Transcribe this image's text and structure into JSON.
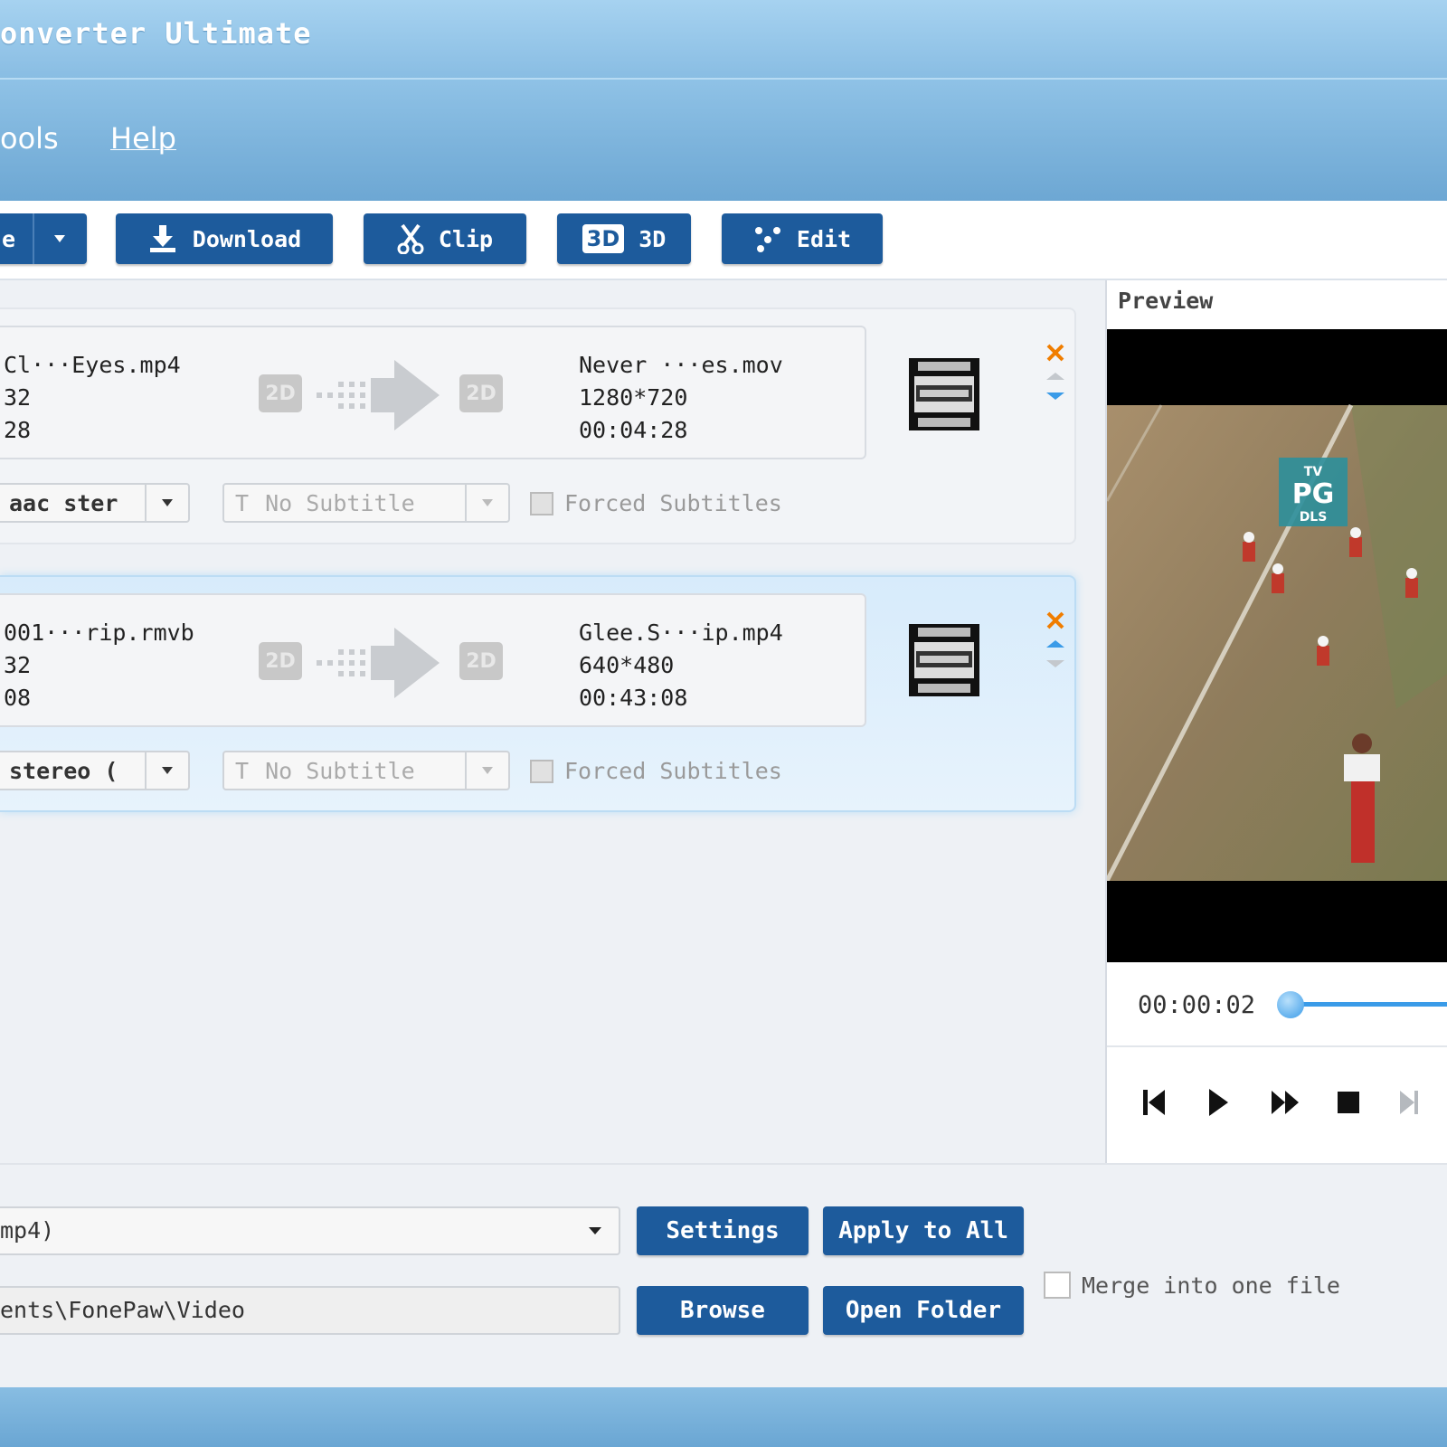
{
  "window": {
    "title": "onverter Ultimate"
  },
  "menu": {
    "items": [
      "ools",
      "Help"
    ]
  },
  "toolbar": {
    "buttons": [
      {
        "label": "e",
        "icon": "add-file-icon"
      },
      {
        "label": "Download",
        "icon": "download-icon"
      },
      {
        "label": "Clip",
        "icon": "scissors-icon"
      },
      {
        "label": "3D",
        "icon": "3d-icon",
        "badge": "3D"
      },
      {
        "label": "Edit",
        "icon": "edit-icon"
      }
    ]
  },
  "files": [
    {
      "source": {
        "name": "Cl···Eyes.mp4",
        "resolution": "32",
        "duration": "28"
      },
      "source_badge": "2D",
      "target_badge": "2D",
      "target": {
        "name": "Never ···es.mov",
        "resolution": "1280*720",
        "duration": "00:04:28"
      },
      "audio": "aac ster",
      "subtitle": "No Subtitle",
      "subtitle_icon": "T",
      "forced_label": "Forced Subtitles",
      "selected": false
    },
    {
      "source": {
        "name": "001···rip.rmvb",
        "resolution": "32",
        "duration": "08"
      },
      "source_badge": "2D",
      "target_badge": "2D",
      "target": {
        "name": "Glee.S···ip.mp4",
        "resolution": "640*480",
        "duration": "00:43:08"
      },
      "audio": "stereo (",
      "subtitle": "No Subtitle",
      "subtitle_icon": "T",
      "forced_label": "Forced Subtitles",
      "selected": true
    }
  ],
  "preview": {
    "label": "Preview",
    "time": "00:00:02",
    "progress": 0.0,
    "rating_badge": {
      "line1": "TV",
      "line2": "PG",
      "line3": "DLS"
    }
  },
  "output": {
    "profile_value": "mp4)",
    "settings_label": "Settings",
    "apply_all_label": "Apply to All",
    "destination_value": "ents\\FonePaw\\Video",
    "browse_label": "Browse",
    "open_folder_label": "Open Folder",
    "merge_label": "Merge into one file",
    "merge_checked": false
  },
  "colors": {
    "button_blue": "#1d5b9c",
    "title_blue": "#a6d2f0",
    "close_orange": "#f07d00",
    "arrow_blue": "#3a9be8"
  }
}
